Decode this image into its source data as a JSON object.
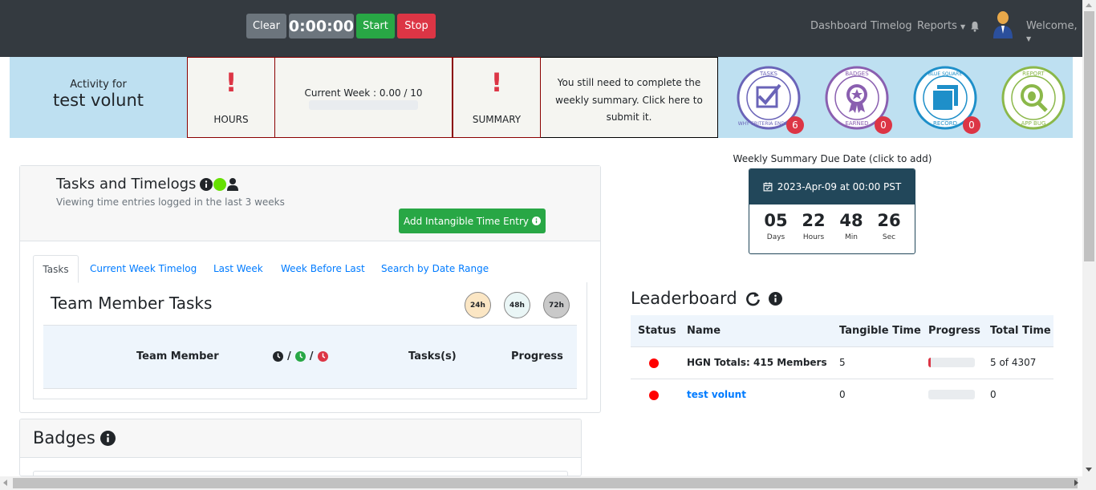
{
  "navbar": {
    "clear_label": "Clear",
    "timer": "0:00:00",
    "start_label": "Start",
    "stop_label": "Stop",
    "links": {
      "dashboard": "Dashboard",
      "timelog": "Timelog",
      "reports": "Reports"
    },
    "welcome": "Welcome,"
  },
  "summary_bar": {
    "activity_label": "Activity for",
    "user_name": "test volunt",
    "hours_alert": "!",
    "hours_label": "HOURS",
    "current_week": "Current Week : 0.00 / 10",
    "current_week_progress": 0,
    "summary_alert": "!",
    "summary_label": "SUMMARY",
    "summary_message": "You still need to complete the weekly summary. Click here to submit it.",
    "badges": [
      {
        "name": "tasks",
        "top_text": "TASKS",
        "bottom_text": "WHY CRITERIA ENDSTATE",
        "color": "#6a64b8",
        "count": "6"
      },
      {
        "name": "badges-earned",
        "top_text": "BADGES",
        "bottom_text": "EARNED",
        "color": "#8a5fb0",
        "count": "0"
      },
      {
        "name": "blue-square-record",
        "top_text": "BLUE SQUARE",
        "bottom_text": "RECORD",
        "color": "#1e8fc9",
        "count": "0"
      },
      {
        "name": "report-app-bug",
        "top_text": "REPORT",
        "bottom_text": "APP BUG",
        "color": "#8bb84a",
        "count": ""
      }
    ]
  },
  "tasks_card": {
    "title": "Tasks and Timelogs",
    "subtitle": "Viewing time entries logged in the last 3 weeks",
    "add_intangible_label": "Add Intangible Time Entry",
    "tabs": [
      "Tasks",
      "Current Week Timelog",
      "Last Week",
      "Week Before Last",
      "Search by Date Range"
    ],
    "team_member_tasks_title": "Team Member Tasks",
    "hour_filters": [
      "24h",
      "48h",
      "72h"
    ],
    "table_headers": {
      "team_member": "Team Member",
      "tasks": "Tasks(s)",
      "progress": "Progress"
    },
    "clock_separator": "/"
  },
  "badges_card": {
    "title": "Badges"
  },
  "weekly_due": {
    "label": "Weekly Summary Due Date (click to add)",
    "date": "2023-Apr-09 at 00:00 PST",
    "days": "05",
    "days_label": "Days",
    "hours": "22",
    "hours_label": "Hours",
    "minutes": "48",
    "minutes_label": "Min",
    "seconds": "26",
    "seconds_label": "Sec"
  },
  "leaderboard": {
    "title": "Leaderboard",
    "headers": {
      "status": "Status",
      "name": "Name",
      "tangible": "Tangible Time",
      "progress": "Progress",
      "total": "Total Time"
    },
    "rows": [
      {
        "name": "HGN Totals: 415 Members",
        "tangible": "5",
        "progress": 0.05,
        "total": "5 of 4307",
        "link": false
      },
      {
        "name": "test volunt",
        "tangible": "0",
        "progress": 0,
        "total": "0",
        "link": true
      }
    ]
  },
  "colors": {
    "navbar": "#343a40",
    "success": "#28a745",
    "danger": "#dc3545",
    "summary_bar": "#bee0f1",
    "due_header": "#22475a",
    "link": "#007bff"
  }
}
